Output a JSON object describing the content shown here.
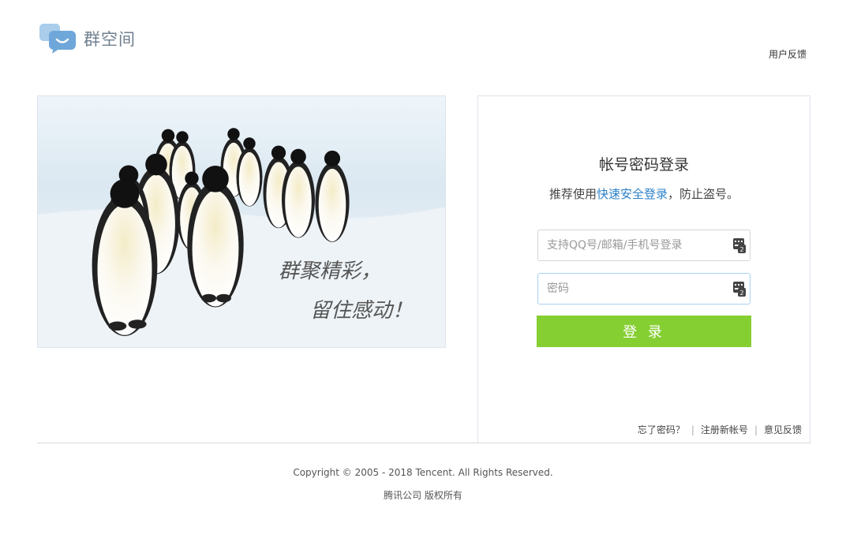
{
  "header": {
    "logo_text": "群空间",
    "feedback_link": "用户反馈"
  },
  "banner": {
    "slogan_line1": "群聚精彩，",
    "slogan_line2": "留住感动！"
  },
  "login": {
    "title": "帐号密码登录",
    "tip_prefix": "推荐使用",
    "tip_link": "快速安全登录",
    "tip_suffix": "，防止盗号。",
    "username_placeholder": "支持QQ号/邮箱/手机号登录",
    "username_value": "",
    "password_placeholder": "密码",
    "password_value": "",
    "submit_label": "登 录",
    "forgot_password": "忘了密码？",
    "separator": "|",
    "register": "注册新帐号",
    "feedback": "意见反馈"
  },
  "footer": {
    "copyright": "Copyright © 2005 - 2018 Tencent. All Rights Reserved.",
    "company": "腾讯公司 版权所有"
  },
  "colors": {
    "accent_green": "#86cf33",
    "link_blue": "#2e82c8",
    "logo_blue": "#6fa7da"
  }
}
